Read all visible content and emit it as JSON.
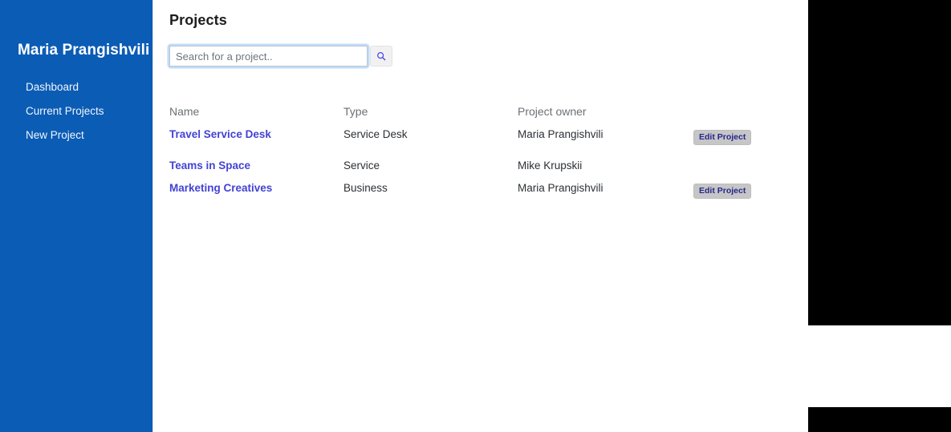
{
  "sidebar": {
    "user_name": "Maria Prangishvili",
    "items": [
      {
        "label": "Dashboard"
      },
      {
        "label": "Current Projects"
      },
      {
        "label": "New Project"
      }
    ],
    "background_color": "#0b5cb5"
  },
  "main": {
    "page_title": "Projects",
    "search": {
      "placeholder": "Search for a project..",
      "value": "",
      "button_icon": "search-icon"
    },
    "table": {
      "columns": [
        "Name",
        "Type",
        "Project owner",
        ""
      ],
      "rows": [
        {
          "name": "Travel Service Desk",
          "type": "Service Desk",
          "owner": "Maria Prangishvili",
          "action_label": "Edit Project",
          "has_action": true
        },
        {
          "name": "Teams in Space",
          "type": "Service",
          "owner": "Mike Krupskii",
          "action_label": "",
          "has_action": false
        },
        {
          "name": "Marketing Creatives",
          "type": "Business",
          "owner": "Maria Prangishvili",
          "action_label": "Edit Project",
          "has_action": true
        }
      ]
    }
  },
  "colors": {
    "sidebar_blue": "#0b5cb5",
    "link_blue": "#4242d6",
    "button_gray": "#c6c6c6",
    "button_text": "#26268c",
    "header_gray": "#6b7075",
    "focus_glow": "#78afeb"
  }
}
